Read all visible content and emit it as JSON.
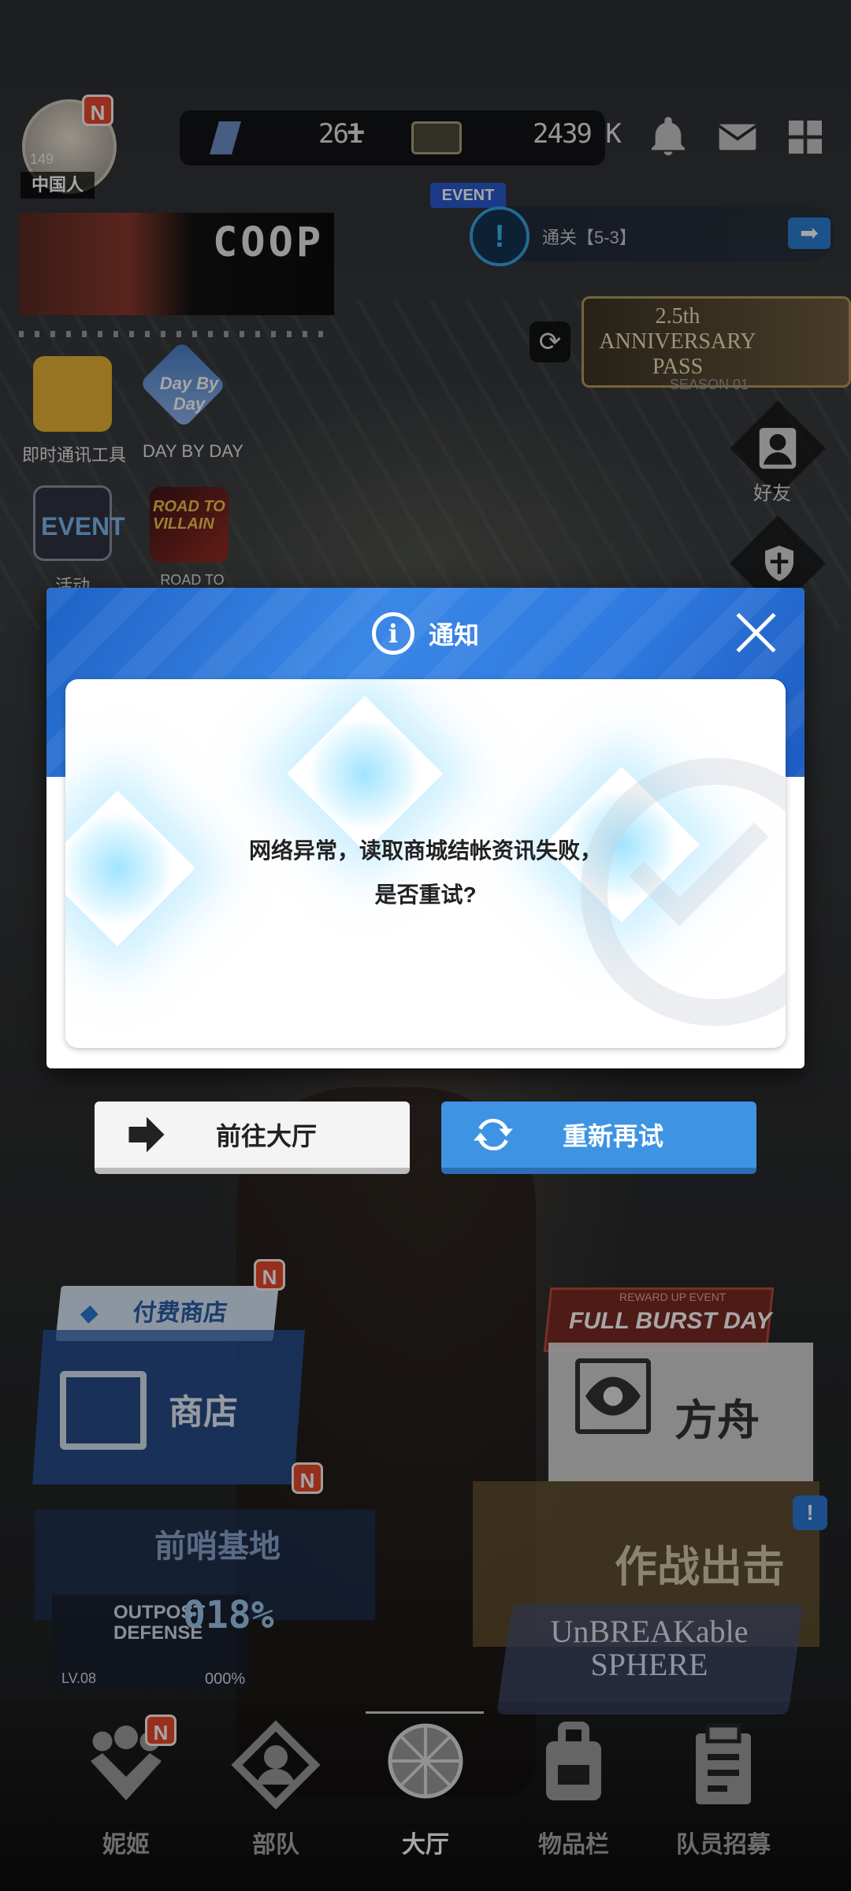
{
  "header": {
    "player_name": "中国人",
    "player_level": "149",
    "avatar_badge": "N",
    "gems": "261",
    "gems_plus": "+",
    "credits": "2439 K"
  },
  "banner": {
    "event_art_text": "COOP"
  },
  "event": {
    "tag": "EVENT",
    "quest_icon": "!",
    "quest_text": "通关【5-3】",
    "arrow": "➡"
  },
  "anniversary": {
    "line1": "2.5th",
    "line2": "ANNIVERSARY",
    "line3": "PASS",
    "subtitle": "SEASON 01"
  },
  "apps": [
    {
      "label": "即时通讯工具"
    },
    {
      "label": "DAY BY DAY",
      "art": "Day By Day"
    },
    {
      "label": "活动",
      "art": "EVENT"
    },
    {
      "label": "ROAD TO",
      "art": "ROAD TO VILLAIN"
    }
  ],
  "side": {
    "friends_label": "好友"
  },
  "modal": {
    "title": "通知",
    "message_line1": "网络异常，读取商城结帐资讯失败，",
    "message_line2": "是否重试?",
    "goto_label": "前往大厅",
    "retry_label": "重新再试"
  },
  "panels": {
    "paid_shop": "付费商店",
    "paid_shop_badge": "N",
    "shop": "商店",
    "outpost": "前哨基地",
    "outpost_badge": "N",
    "outpost_title_1": "OUTPOST",
    "outpost_title_2": "DEFENSE",
    "outpost_percent": "018%",
    "outpost_level": "LV.08",
    "outpost_small": "000%",
    "fullburst_event": "REWARD UP EVENT",
    "fullburst": "FULL BURST DAY",
    "ark": "方舟",
    "battle": "作战出击",
    "battle_badge": "!",
    "unbreakable_line1": "UnBREAKable",
    "unbreakable_line2": "SPHERE"
  },
  "nav": {
    "items": [
      {
        "label": "妮姬",
        "badge": "N"
      },
      {
        "label": "部队"
      },
      {
        "label": "大厅"
      },
      {
        "label": "物品栏"
      },
      {
        "label": "队员招募"
      }
    ],
    "active_index": 2
  },
  "colors": {
    "modal_header": "#2f7ae0",
    "retry_button": "#3e93e3",
    "badge": "#e8492d"
  }
}
